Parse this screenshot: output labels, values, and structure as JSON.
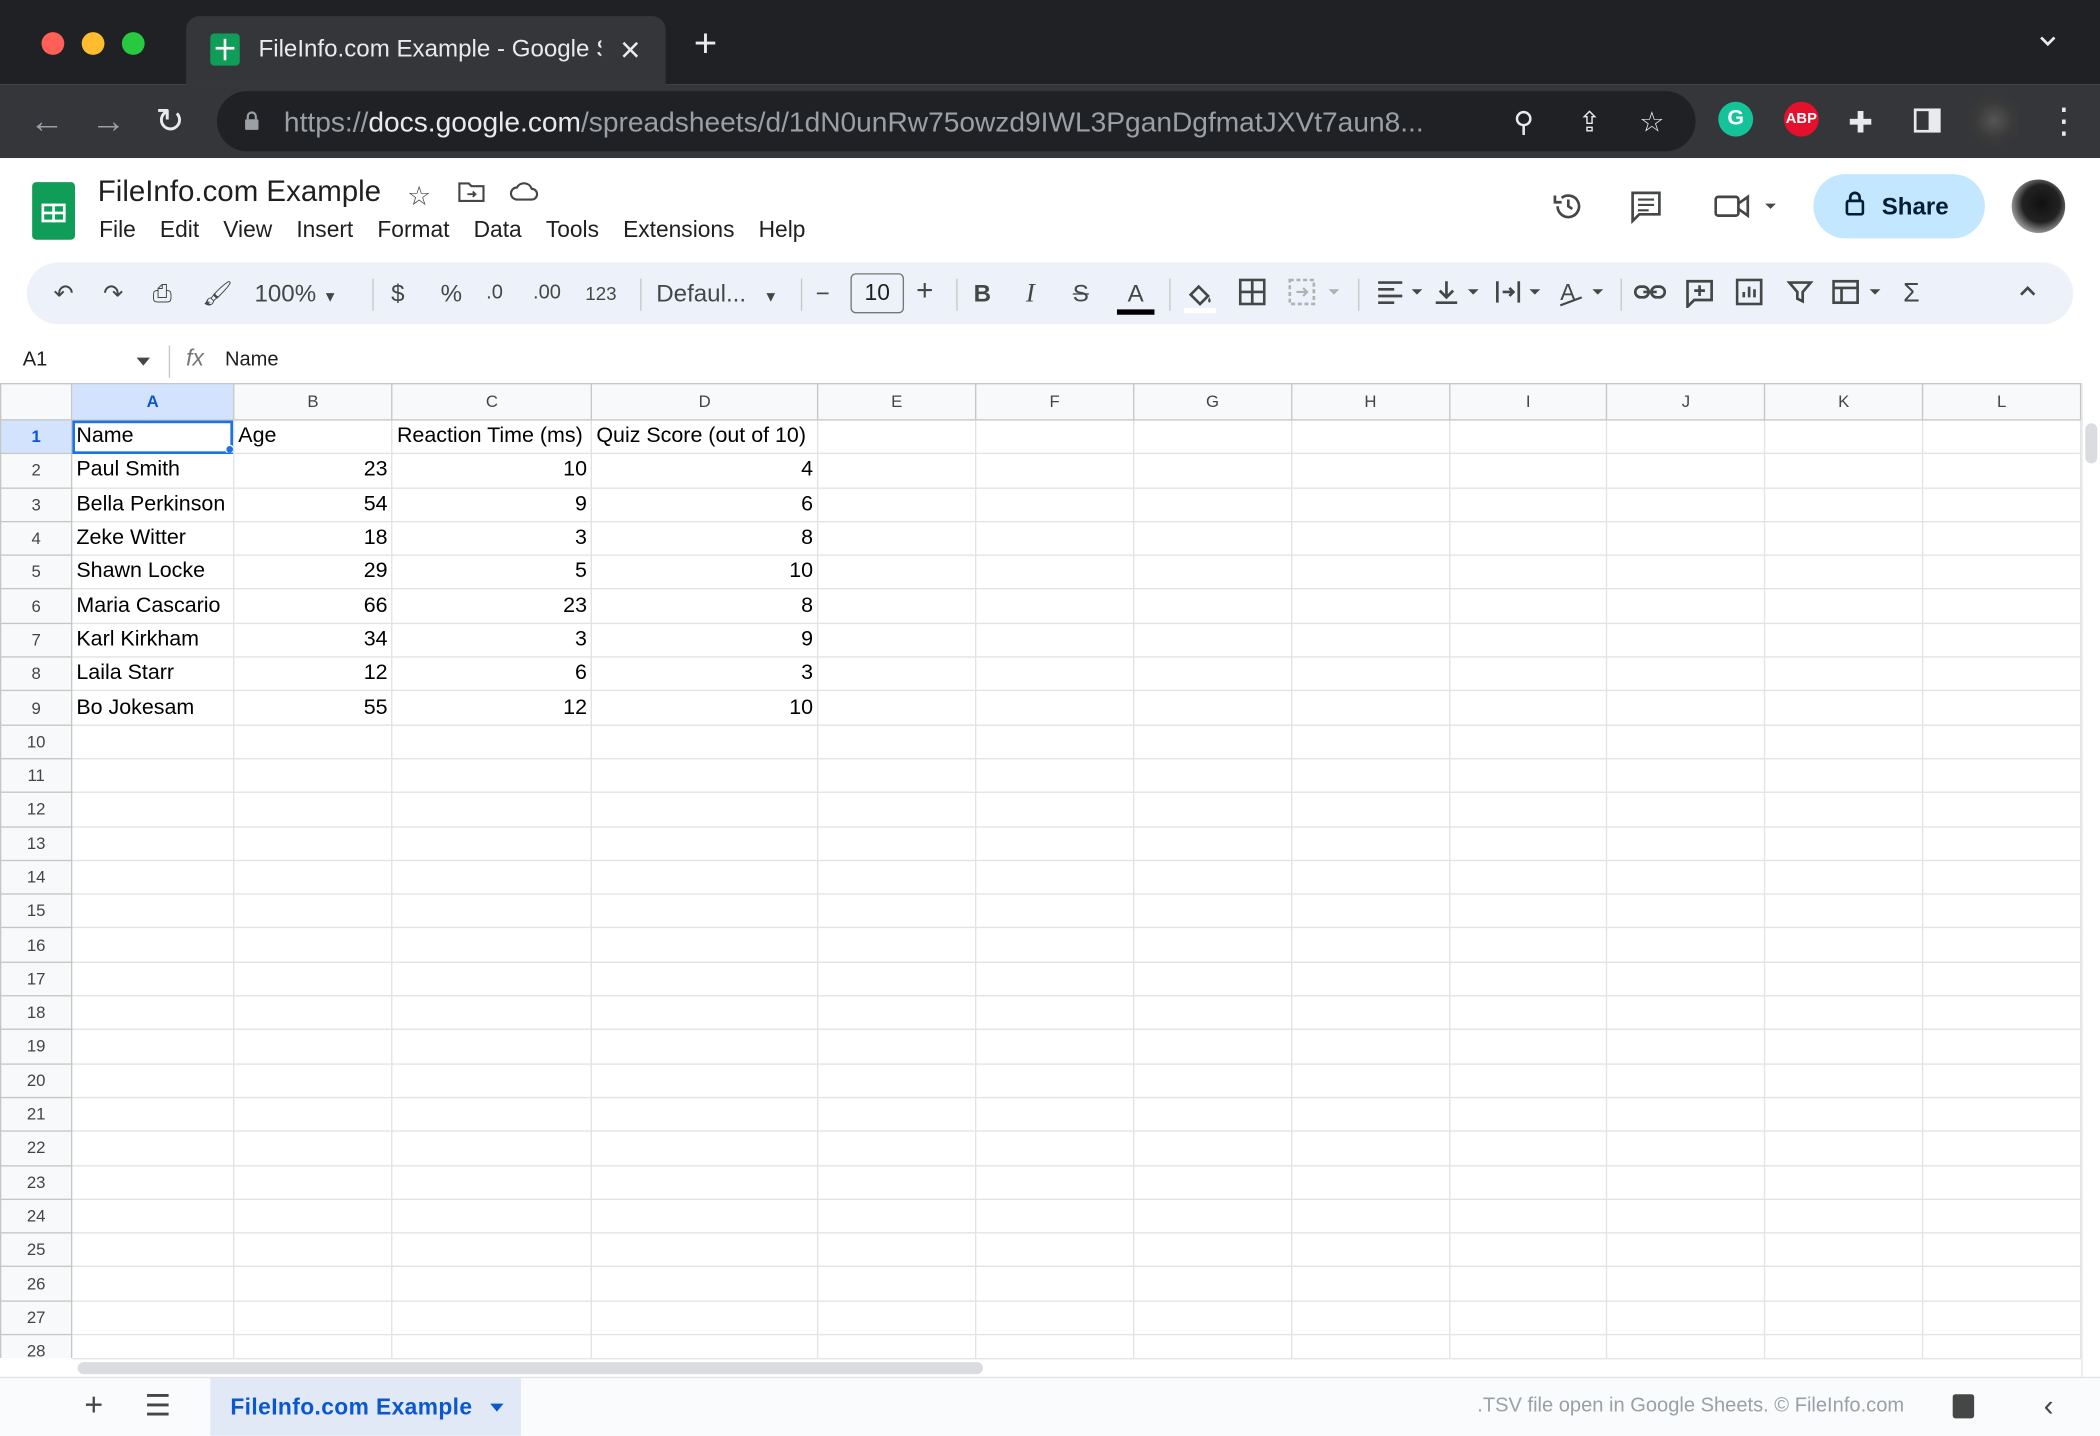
{
  "browser": {
    "tab_title": "FileInfo.com Example - Google Sheets",
    "url_prefix": "https://",
    "url_host": "docs.google.com",
    "url_path": "/spreadsheets/d/1dN0unRw75owzd9IWL3PganDgfmatJXVt7aun8..."
  },
  "doc": {
    "title": "FileInfo.com Example",
    "menu": [
      "File",
      "Edit",
      "View",
      "Insert",
      "Format",
      "Data",
      "Tools",
      "Extensions",
      "Help"
    ],
    "share_label": "Share"
  },
  "toolbar": {
    "zoom": "100%",
    "currency": "$",
    "percent": "%",
    "dec_decrease": ".0",
    "dec_increase": ".00",
    "more_formats": "123",
    "font": "Defaul...",
    "font_size": "10"
  },
  "formula_bar": {
    "cell_ref": "A1",
    "fx": "fx",
    "value": "Name"
  },
  "columns": [
    "A",
    "B",
    "C",
    "D",
    "E",
    "F",
    "G",
    "H",
    "I",
    "J",
    "K",
    "L"
  ],
  "rows": [
    [
      "Name",
      "Age",
      "Reaction Time (ms)",
      "Quiz Score (out of 10)"
    ],
    [
      "Paul Smith",
      "23",
      "10",
      "4"
    ],
    [
      "Bella Perkinson",
      "54",
      "9",
      "6"
    ],
    [
      "Zeke Witter",
      "18",
      "3",
      "8"
    ],
    [
      "Shawn Locke",
      "29",
      "5",
      "10"
    ],
    [
      "Maria Cascario",
      "66",
      "23",
      "8"
    ],
    [
      "Karl Kirkham",
      "34",
      "3",
      "9"
    ],
    [
      "Laila Starr",
      "12",
      "6",
      "3"
    ],
    [
      "Bo Jokesam",
      "55",
      "12",
      "10"
    ]
  ],
  "row_count": 28,
  "bottom": {
    "sheet_tab": "FileInfo.com Example",
    "credit": ".TSV file open in Google Sheets. © FileInfo.com"
  },
  "colors": {
    "accent": "#0b57d0",
    "share_bg": "#c2e7ff",
    "sheets_green": "#0f9d58"
  }
}
